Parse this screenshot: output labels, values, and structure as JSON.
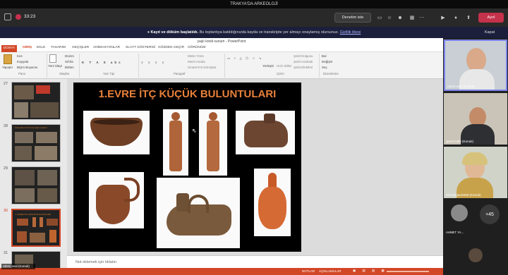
{
  "window": {
    "title": "TRAKYA'DA ARKEOLOJİ"
  },
  "meeting": {
    "timer": "33:23",
    "meeting_label": "Denetim iste",
    "leave_label": "Ayrıl"
  },
  "recording": {
    "bold": "Kayıt ve döküm başlatıldı.",
    "text": "Bu toplantıya katıldığınızda kayda ve transkripte yer almayı onaylamış olursunuz.",
    "link": "Gizlilik ilkesi",
    "close": "Kapat"
  },
  "ppt": {
    "title": "yaşlı kredi sunum - PowerPoint",
    "tabs": [
      "DOSYA",
      "GİRİŞ",
      "EKLE",
      "TASARIM",
      "GEÇİŞLER",
      "ANİMASYONLAR",
      "SLAYT GÖSTERİSİ",
      "GÖZDEN GEÇİR",
      "GÖRÜNÜM"
    ],
    "user": "Rahmi Asal",
    "ribbon": {
      "paste": "Yapıştır",
      "cut": "Kes",
      "copy": "Kopyala",
      "format_painter": "Biçim Boyacısı",
      "new_slide": "Yeni Slayt",
      "layout": "Düzen",
      "reset": "Sıfırla",
      "section": "Bölüm",
      "text_dir": "Metin Yönü",
      "align_text": "Metni Hizala",
      "smartart": "SmartArt'a Dönüştür",
      "arrange": "Yerleştir",
      "quick_styles": "Hızlı Stiller",
      "shape_fill": "Şekil Dolgusu",
      "shape_outline": "Şekil Anahattı",
      "shape_effects": "Şekil Efektleri",
      "find": "Bul",
      "replace": "Değiştir",
      "select": "Seç",
      "grp_clipboard": "Pano",
      "grp_slides": "Slaytlar",
      "grp_font": "Yazı Tipi",
      "grp_paragraph": "Paragraf",
      "grp_drawing": "Çizim",
      "grp_editing": "Düzenleme"
    },
    "slide_numbers": [
      "27",
      "28",
      "29",
      "30",
      "31"
    ],
    "thumb30_title": "1. EVRE İTÇ KÜÇÜK BULUNTULARI",
    "thumb28_title": "Avra erken Üst Tunç Çağ ve demir",
    "slide_title": "1.EVRE İTÇ KÜÇÜK BULUNTULARI",
    "notes_placeholder": "Not eklemek için tıklatın",
    "status_notes": "NOTLAR",
    "status_comments": "AÇIKLAMALAR"
  },
  "participants": [
    {
      "name": "rahmi asal (Konuk)"
    },
    {
      "name": "Şenol Altık (Konuk)"
    },
    {
      "name": "erlerdogan2006 (Konuk)"
    },
    {
      "name": "AHMET YA..."
    },
    {
      "name": "+45"
    }
  ],
  "self_view": {
    "name": "rahmi asal (Konuk)"
  }
}
